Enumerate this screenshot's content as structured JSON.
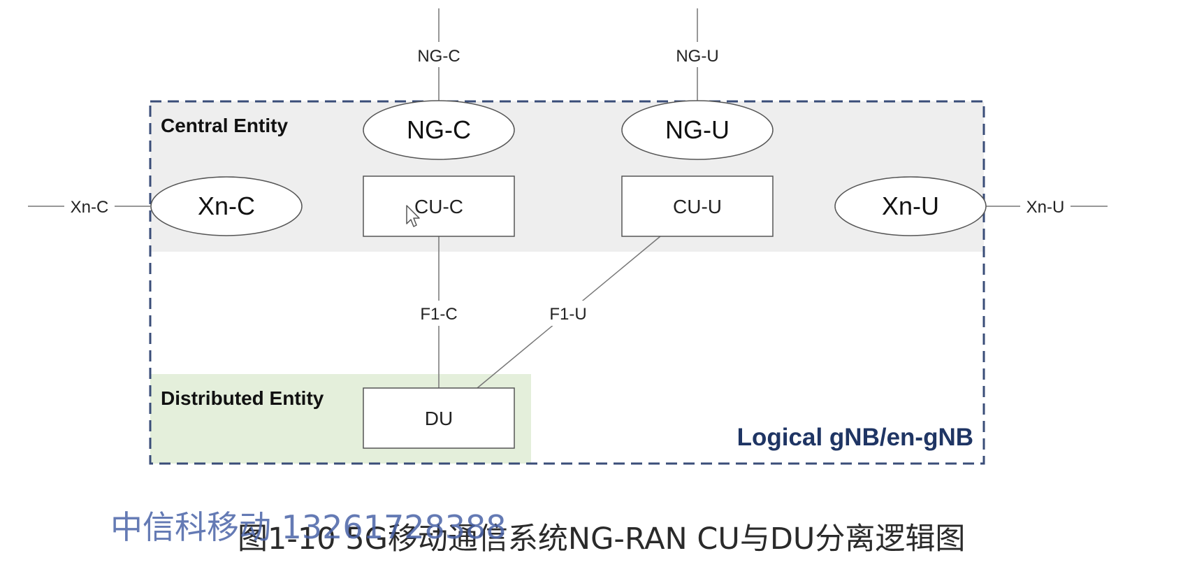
{
  "interfaces": {
    "ng_c": "NG-C",
    "ng_u": "NG-U",
    "xn_c": "Xn-C",
    "xn_u": "Xn-U",
    "f1_c": "F1-C",
    "f1_u": "F1-U"
  },
  "nodes": {
    "ng_c": "NG-C",
    "ng_u": "NG-U",
    "xn_c": "Xn-C",
    "xn_u": "Xn-U",
    "cu_c": "CU-C",
    "cu_u": "CU-U",
    "du": "DU"
  },
  "regions": {
    "central": "Central Entity",
    "distributed": "Distributed Entity",
    "gnb": "Logical gNB/en-gNB"
  },
  "caption": "图1-10 5G移动通信系统NG-RAN CU与DU分离逻辑图",
  "watermark": "中信科移动 13261728388",
  "colors": {
    "central_bg": "#eeeeee",
    "distributed_bg": "#e4efdb",
    "border_dash": "#3a4d78",
    "gnb_label": "#1f3564",
    "watermark": "#4a63a8"
  },
  "icons": [
    "cursor-arrow-icon"
  ]
}
